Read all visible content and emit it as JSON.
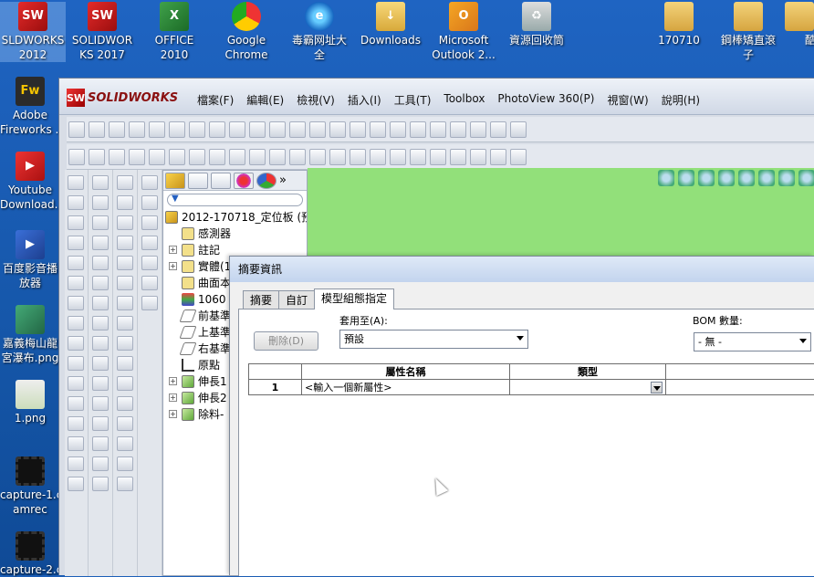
{
  "desktop": {
    "top_icons": [
      {
        "label": "SLDWORKS\n2012",
        "icon": "solidworks-icon"
      },
      {
        "label": "SOLIDWOR\nKS 2017",
        "icon": "solidworks-2017-icon"
      },
      {
        "label": "OFFICE\n2010",
        "icon": "excel-icon"
      },
      {
        "label": "Google\nChrome",
        "icon": "chrome-icon"
      },
      {
        "label": "毒霸网址大\n全",
        "icon": "ie-icon"
      },
      {
        "label": "Downloads",
        "icon": "downloads-folder-icon"
      },
      {
        "label": "Microsoft\nOutlook 2...",
        "icon": "outlook-icon"
      },
      {
        "label": "資源回收筒",
        "icon": "recycle-bin-icon"
      },
      {
        "label": "170710",
        "icon": "folder-icon"
      },
      {
        "label": "鋼棒矯直滾\n子",
        "icon": "folder-icon"
      },
      {
        "label": "酷",
        "icon": "folder-icon"
      }
    ],
    "left_icons": [
      {
        "label": "Adobe\nFireworks ...",
        "icon": "fireworks-icon"
      },
      {
        "label": "Youtube\nDownload...",
        "icon": "youtube-downloader-icon"
      },
      {
        "label": "百度影音播\n放器",
        "icon": "baidu-player-icon"
      },
      {
        "label": "嘉義梅山龍\n宮瀑布.png",
        "icon": "image-file-icon"
      },
      {
        "label": "1.png",
        "icon": "image-file-icon"
      },
      {
        "label": "capture-1.c\namrec",
        "icon": "camrec-file-icon"
      },
      {
        "label": "capture-2.c",
        "icon": "camrec-file-icon"
      }
    ]
  },
  "solidworks": {
    "logo_text": "SOLIDWORKS",
    "menu": [
      "檔案(F)",
      "編輯(E)",
      "檢視(V)",
      "插入(I)",
      "工具(T)",
      "Toolbox",
      "PhotoView 360(P)",
      "視窗(W)",
      "說明(H)"
    ],
    "tree": {
      "root": "2012-170718_定位板 (預",
      "items": [
        {
          "label": "感測器",
          "expandable": false
        },
        {
          "label": "註記",
          "expandable": true
        },
        {
          "label": "實體(1",
          "expandable": true
        },
        {
          "label": "曲面本",
          "expandable": false
        },
        {
          "label": "1060 -",
          "expandable": false
        },
        {
          "label": "前基準",
          "expandable": false
        },
        {
          "label": "上基準",
          "expandable": false
        },
        {
          "label": "右基準",
          "expandable": false
        },
        {
          "label": "原點",
          "expandable": false
        },
        {
          "label": "伸長1",
          "expandable": true
        },
        {
          "label": "伸長2",
          "expandable": true
        },
        {
          "label": "除料-",
          "expandable": true
        }
      ]
    },
    "colors": {
      "graphics_bg": "#92e07a",
      "brand_red": "#c81414"
    }
  },
  "dialog": {
    "title": "摘要資訊",
    "tabs": [
      "摘要",
      "自訂",
      "模型組態指定"
    ],
    "active_tab": "模型組態指定",
    "delete_label": "刪除(D)",
    "apply_label": "套用至(A):",
    "apply_value": "預設",
    "bom_label": "BOM 數量:",
    "bom_value": "- 無 -",
    "table": {
      "headers": [
        "",
        "屬性名稱",
        "類型",
        ""
      ],
      "rows": [
        {
          "num": "1",
          "name": "<輸入一個新屬性>",
          "type": ""
        }
      ]
    }
  }
}
